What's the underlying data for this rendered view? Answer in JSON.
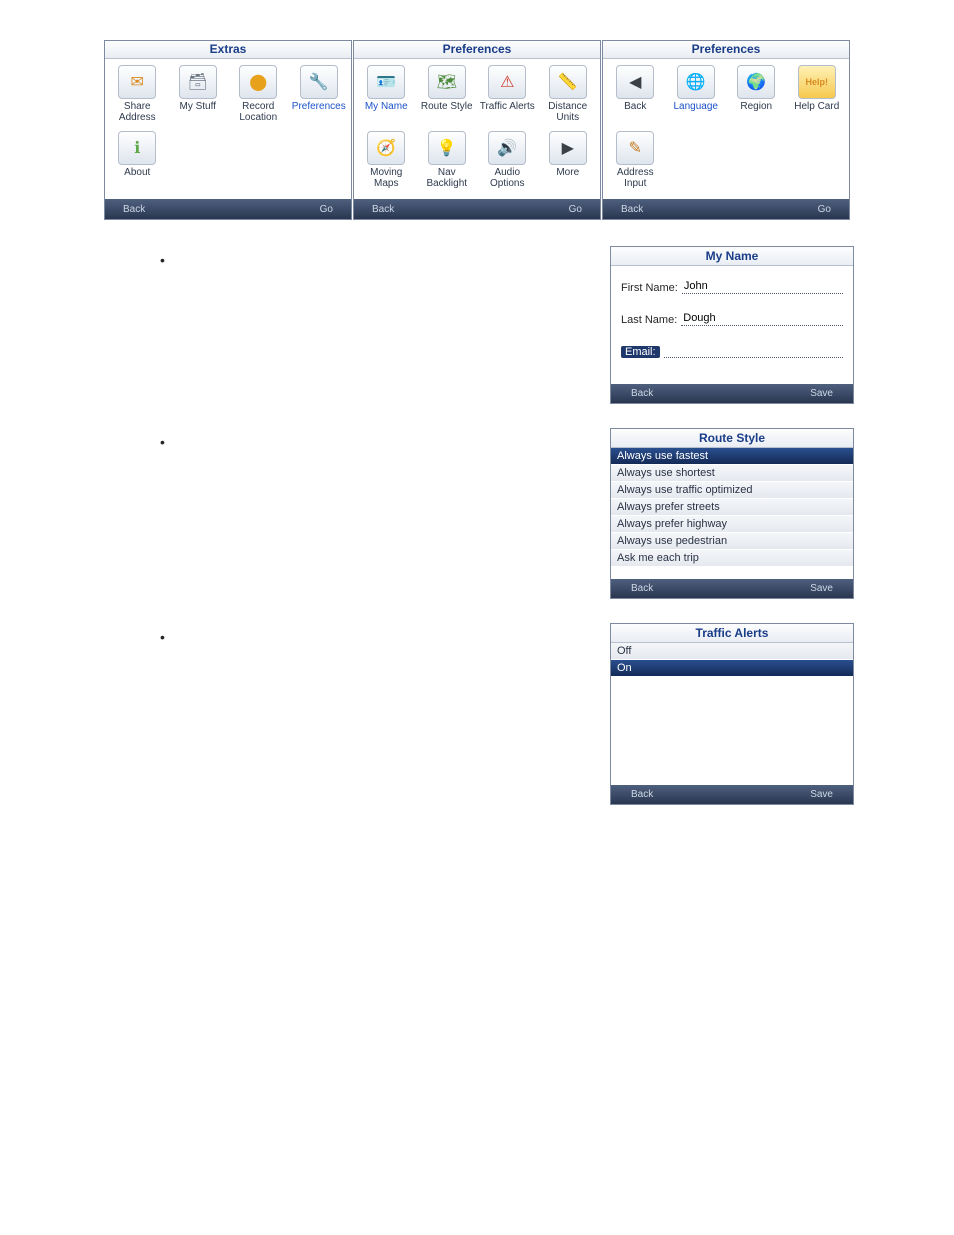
{
  "shots": [
    {
      "title": "Extras",
      "footer": {
        "back": "Back",
        "go": "Go"
      },
      "items": [
        {
          "name": "share-address",
          "label": "Share Address",
          "glyph": "✉",
          "glyphColor": "#d98b1f"
        },
        {
          "name": "my-stuff",
          "label": "My Stuff",
          "glyph": "🗃",
          "glyphColor": "#6d7886"
        },
        {
          "name": "record-location",
          "label": "Record Location",
          "glyph": "⬤",
          "glyphColor": "#e7a11a"
        },
        {
          "name": "preferences",
          "label": "Preferences",
          "glyph": "🔧",
          "glyphColor": "#3d7fd6",
          "selected": true
        },
        {
          "name": "about",
          "label": "About",
          "glyph": "ℹ",
          "glyphColor": "#5fa84a"
        }
      ]
    },
    {
      "title": "Preferences",
      "footer": {
        "back": "Back",
        "go": "Go"
      },
      "items": [
        {
          "name": "my-name",
          "label": "My Name",
          "glyph": "🪪",
          "glyphColor": "#7ea4d7",
          "selected": true
        },
        {
          "name": "route-style",
          "label": "Route Style",
          "glyph": "🗺",
          "glyphColor": "#4b8a3a"
        },
        {
          "name": "traffic-alerts",
          "label": "Traffic Alerts",
          "glyph": "⚠",
          "glyphColor": "#cc3b2c"
        },
        {
          "name": "distance-units",
          "label": "Distance Units",
          "glyph": "📏",
          "glyphColor": "#4b8a3a"
        },
        {
          "name": "moving-maps",
          "label": "Moving Maps",
          "glyph": "🧭",
          "glyphColor": "#4b8a3a"
        },
        {
          "name": "nav-backlight",
          "label": "Nav Backlight",
          "glyph": "💡",
          "glyphColor": "#e0c63a"
        },
        {
          "name": "audio-options",
          "label": "Audio Options",
          "glyph": "🔊",
          "glyphColor": "#d78c2a"
        },
        {
          "name": "more",
          "label": "More",
          "glyph": "▶",
          "glyphColor": "#3a3f48"
        }
      ]
    },
    {
      "title": "Preferences",
      "footer": {
        "back": "Back",
        "go": "Go"
      },
      "items": [
        {
          "name": "back",
          "label": "Back",
          "glyph": "◀",
          "glyphColor": "#3a3f48"
        },
        {
          "name": "language",
          "label": "Language",
          "glyph": "🌐",
          "glyphColor": "#c97a2a",
          "selected": true
        },
        {
          "name": "region",
          "label": "Region",
          "glyph": "🌍",
          "glyphColor": "#2f73c9"
        },
        {
          "name": "help-card",
          "label": "Help Card",
          "glyph": "Help!",
          "glyphColor": "#d98b1f",
          "small": true
        },
        {
          "name": "address-input",
          "label": "Address Input",
          "glyph": "✎",
          "glyphColor": "#c27b1f"
        }
      ]
    }
  ],
  "myName": {
    "title": "My Name",
    "fields": {
      "first": {
        "label": "First Name:",
        "value": "John"
      },
      "last": {
        "label": "Last Name:",
        "value": "Dough"
      },
      "email": {
        "label": "Email:",
        "value": ""
      }
    },
    "footer": {
      "back": "Back",
      "save": "Save"
    }
  },
  "routeStyle": {
    "title": "Route Style",
    "options": [
      {
        "label": "Always use fastest",
        "selected": true
      },
      {
        "label": "Always use shortest"
      },
      {
        "label": "Always use traffic optimized"
      },
      {
        "label": "Always prefer streets"
      },
      {
        "label": "Always prefer highway"
      },
      {
        "label": "Always use pedestrian"
      },
      {
        "label": "Ask me each trip"
      }
    ],
    "footer": {
      "back": "Back",
      "save": "Save"
    }
  },
  "trafficAlerts": {
    "title": "Traffic Alerts",
    "options": [
      {
        "label": "Off"
      },
      {
        "label": "On",
        "selected": true
      }
    ],
    "footer": {
      "back": "Back",
      "save": "Save"
    }
  }
}
